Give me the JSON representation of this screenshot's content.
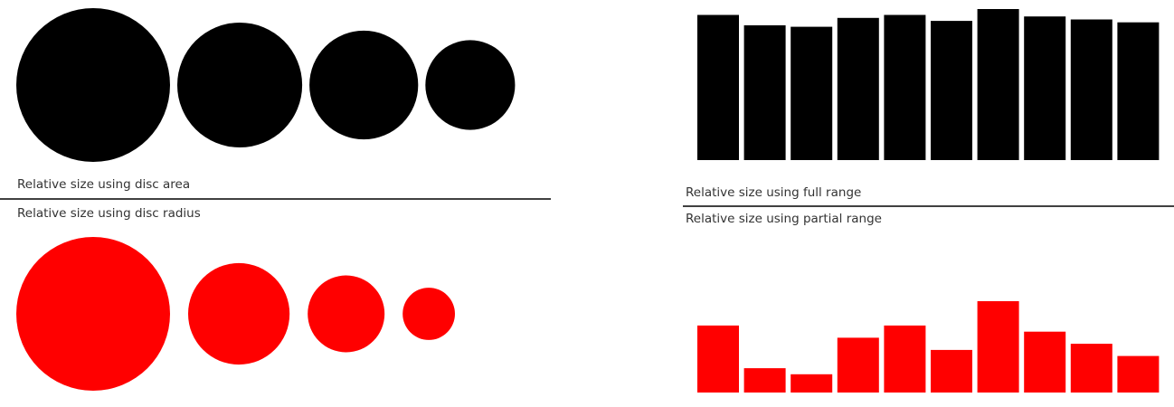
{
  "colors": {
    "top": "#000000",
    "bottom": "#ff0000",
    "label": "#333333",
    "divider": "#000000"
  },
  "chart_data": [
    {
      "type": "scatter",
      "encoding": "disc area",
      "title": "Relative size using disc area",
      "values": [
        100,
        66,
        50,
        34
      ],
      "color": "#000000"
    },
    {
      "type": "scatter",
      "encoding": "disc radius",
      "title": "Relative size using disc radius",
      "values": [
        100,
        66,
        50,
        34
      ],
      "color": "#ff0000"
    },
    {
      "type": "bar",
      "encoding": "full range",
      "title": "Relative size using full range",
      "values": [
        98,
        91,
        90,
        96,
        98,
        94,
        102,
        97,
        95,
        93
      ],
      "ylim": [
        0,
        102
      ],
      "color": "#000000"
    },
    {
      "type": "bar",
      "encoding": "partial range",
      "title": "Relative size using partial range",
      "values": [
        98,
        91,
        90,
        96,
        98,
        94,
        102,
        97,
        95,
        93
      ],
      "ylim": [
        87,
        102
      ],
      "color": "#ff0000"
    }
  ]
}
